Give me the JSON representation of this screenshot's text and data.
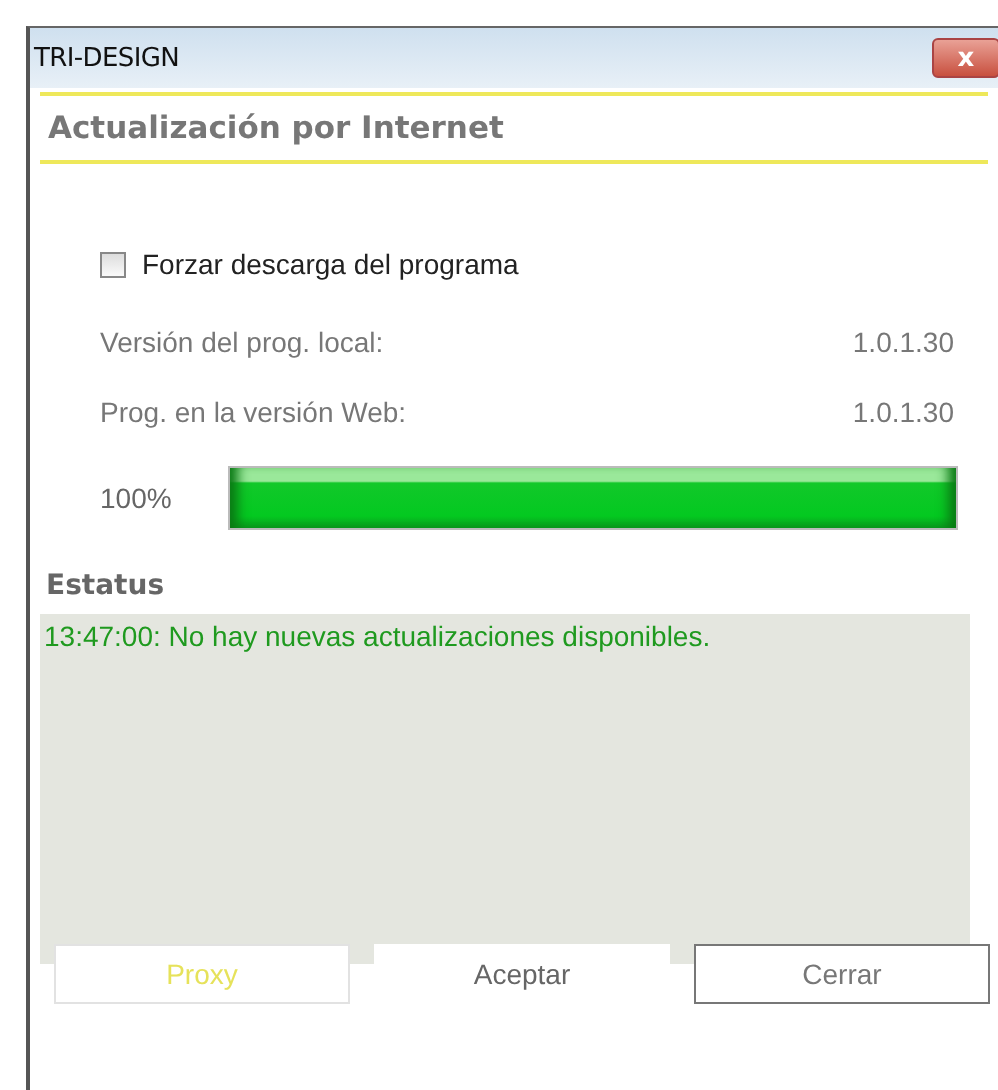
{
  "window": {
    "title": "TRI-DESIGN",
    "close": "x"
  },
  "header": "Actualización por Internet",
  "force_download": {
    "label": "Forzar descarga del programa",
    "checked": false
  },
  "info_rows": [
    {
      "label": "Versión del prog. local:",
      "value": "1.0.1.30"
    },
    {
      "label": "Prog. en la versión Web:",
      "value": "1.0.1.30"
    }
  ],
  "progress": {
    "reading": "100%",
    "level": 1
  },
  "status": {
    "heading": "Estatus",
    "message": "13:47:00: No hay nuevas actualizaciones disponibles."
  },
  "buttons": [
    {
      "label": "Proxy",
      "kind": "disabled"
    },
    {
      "label": "Aceptar",
      "kind": "flat"
    },
    {
      "label": "Cerrar",
      "kind": "outlined"
    }
  ]
}
